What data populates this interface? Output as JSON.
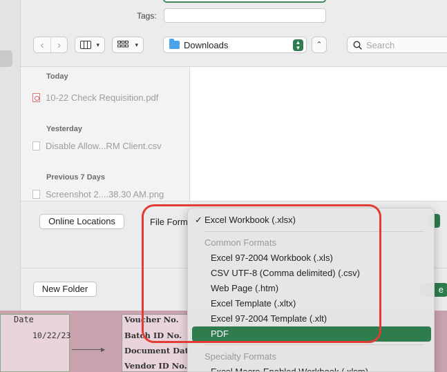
{
  "dialog": {
    "tags_label": "Tags:",
    "location": "Downloads",
    "search_placeholder": "Search"
  },
  "sidebar": {
    "sections": [
      {
        "title": "Today",
        "files": [
          "10-22 Check Requisition.pdf"
        ]
      },
      {
        "title": "Yesterday",
        "files": [
          "Disable Allow...RM Client.csv"
        ]
      },
      {
        "title": "Previous 7 Days",
        "files": [
          "Screenshot 2....38.30 AM.png"
        ]
      }
    ]
  },
  "bottom": {
    "online_locations_label": "Online Locations",
    "file_format_label": "File Form",
    "new_folder_label": "New Folder",
    "save_label": "e"
  },
  "menu": {
    "selected_check": "✓",
    "current": "Excel Workbook (.xlsx)",
    "common_header": "Common Formats",
    "common": [
      "Excel 97-2004 Workbook (.xls)",
      "CSV UTF-8 (Comma delimited) (.csv)",
      "Web Page (.htm)",
      "Excel Template (.xltx)",
      "Excel 97-2004 Template (.xlt)",
      "PDF"
    ],
    "specialty_header": "Specialty Formats",
    "specialty": [
      "Excel Macro-Enabled Workbook (.xlsm)"
    ]
  },
  "sheet": {
    "date_header": "Date",
    "date_value": "10/22/23",
    "labels": [
      "Voucher No.",
      "Batch ID No.",
      "Document Date",
      "Vendor ID No."
    ]
  },
  "colors": {
    "accent": "#2f7d4e",
    "annotation": "#e23a34"
  }
}
